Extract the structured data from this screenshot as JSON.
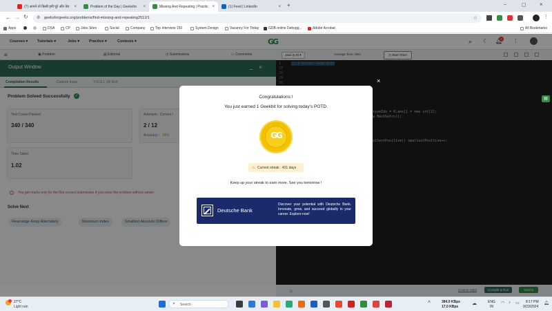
{
  "browser": {
    "tabs": [
      {
        "label": "(7) आपने तो किसी इनी घूरे और तेरा"
      },
      {
        "label": "Problem of the Day | Geeksfor"
      },
      {
        "label": "Missing And Repeating | Practic"
      },
      {
        "label": "(1) Feed | LinkedIn"
      }
    ],
    "new_tab": "+",
    "url": "geeksforgeeks.org/problems/find-missing-and-repeating2512/1",
    "bookmarks": [
      "Apps",
      "DSA",
      "CP",
      "Jobs Sites",
      "Social",
      "Company",
      "Top Interview 150",
      "System Design",
      "Vacancy For Today",
      "GDB online Debugg...",
      "Adobe Acrobat"
    ],
    "all_bookmarks": "All Bookmarks",
    "notification_count": "4"
  },
  "site": {
    "nav": [
      "Courses",
      "Tutorials",
      "Jobs",
      "Practice",
      "Contests"
    ],
    "logo": "GG",
    "problem_tabs": [
      "Problem",
      "Editorial",
      "Submissions",
      "Comments"
    ]
  },
  "editor": {
    "language": "Java (1.8)",
    "avg_time": "Average Time: 30m",
    "start_timer": "Start Timer",
    "line_numbers": [
      "1",
      "27",
      "28",
      "29",
      "30"
    ],
    "code_top": "// } Driver Code Ends",
    "code_lines": [
      "tiveIdx = 0,ans[] = new int[2];",
      "w HashSet<>();",
      "allestPositive)) smallestPositive++;"
    ],
    "custom_input": "Custom Input",
    "compile_run": "Compile & Run",
    "submit": "Submit"
  },
  "output": {
    "title": "Output Window",
    "tabs": [
      "Compilation Results",
      "Custom Input",
      "Y.O.G.I. (AI Bot)"
    ],
    "status": "Problem Solved Successfully",
    "test_cases_label": "Test Cases Passed",
    "test_cases_value": "340 / 340",
    "attempts_label": "Attempts : Correct /",
    "attempts_value": "2 / 12",
    "accuracy_label": "Accuracy :",
    "accuracy_value": "16%",
    "time_label": "Time Taken",
    "time_value": "1.02",
    "notice": "You get marks only for the first correct submission if you solve the problem without viewin",
    "solve_next": "Solve Next",
    "next_problems": [
      "Rearrange Array Alternately",
      "Maximum Index",
      "Smallest Absolute Differe"
    ]
  },
  "modal": {
    "title": "Congratulations !",
    "subtitle": "You just earned 1 Geekbit for solving today's POTD.",
    "coin_logo": "GG",
    "streak": "Current streak : 421 days",
    "message": "Keep up your streak to earn more. See you tomorrow !",
    "close": "×",
    "ad_brand": "Deutsche Bank",
    "ad_text": "Discover your potential with Deutsche Bank. Innovate, grow, and succeed globally in your career. Explore now!"
  },
  "taskbar": {
    "weather_temp": "27°C",
    "weather_desc": "Light rain",
    "search": "Search",
    "net_up": "384.0 KBps",
    "net_down": "17.0 KBps",
    "lang": "ENG",
    "lang_region": "IN",
    "time": "8:17 PM",
    "date": "9/23/2024"
  },
  "colors": {
    "brand_green": "#2f8d46",
    "output_header": "#2f6b58",
    "coin_gold": "#f2c200",
    "ad_navy": "#1b2a6b"
  }
}
